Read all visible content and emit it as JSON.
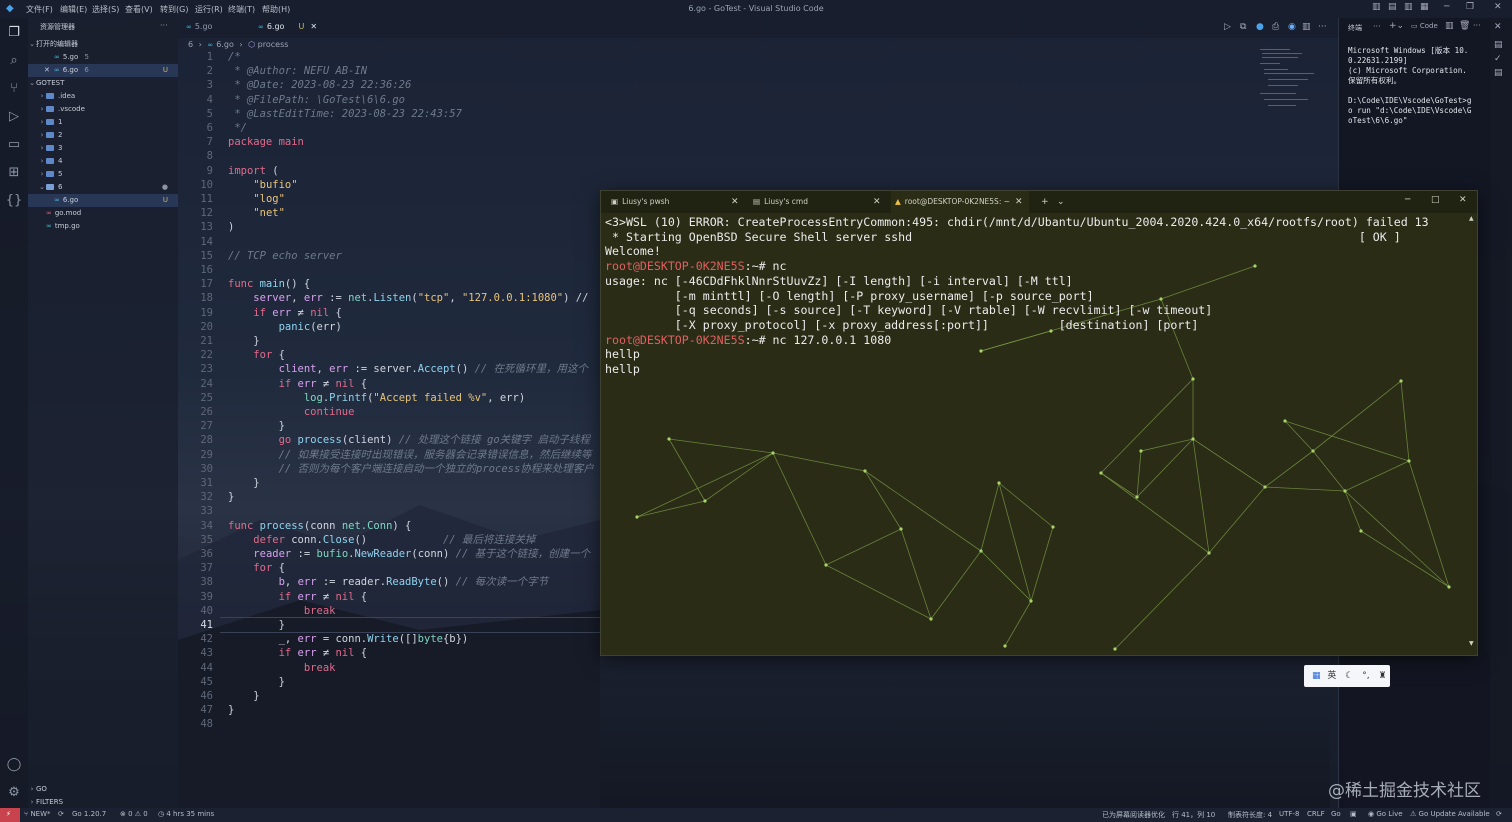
{
  "window": {
    "title": "6.go - GoTest - Visual Studio Code",
    "menu": [
      "文件(F)",
      "编辑(E)",
      "选择(S)",
      "查看(V)",
      "转到(G)",
      "运行(R)",
      "终端(T)",
      "帮助(H)"
    ]
  },
  "sidebar": {
    "header": "资源管理器",
    "open_editors_label": "打开的编辑器",
    "open_editors": [
      {
        "name": "5.go",
        "tag": "5",
        "badge": ""
      },
      {
        "name": "6.go",
        "tag": "6",
        "badge": "U"
      }
    ],
    "project_label": "GOTEST",
    "tree": [
      {
        "name": ".idea",
        "type": "folder"
      },
      {
        "name": ".vscode",
        "type": "folder"
      },
      {
        "name": "1",
        "type": "folder"
      },
      {
        "name": "2",
        "type": "folder"
      },
      {
        "name": "3",
        "type": "folder"
      },
      {
        "name": "4",
        "type": "folder"
      },
      {
        "name": "5",
        "type": "folder"
      },
      {
        "name": "6",
        "type": "folder-open"
      },
      {
        "name": "6.go",
        "type": "go-file",
        "badge": "U"
      },
      {
        "name": "go.mod",
        "type": "mod-file"
      },
      {
        "name": "tmp.go",
        "type": "go-file"
      }
    ],
    "bottom_sections": [
      "GO",
      "FILTERS"
    ]
  },
  "editor": {
    "tabs": [
      {
        "name": "5.go",
        "badge": ""
      },
      {
        "name": "6.go",
        "badge": "U"
      }
    ],
    "breadcrumb": [
      "6",
      "6.go",
      "process"
    ],
    "current_line": 41,
    "lines": [
      {
        "n": "1",
        "segs": [
          [
            "cmt",
            "/*"
          ]
        ]
      },
      {
        "n": "2",
        "segs": [
          [
            "cmt",
            " * @Author: NEFU AB-IN"
          ]
        ]
      },
      {
        "n": "3",
        "segs": [
          [
            "cmt",
            " * @Date: 2023-08-23 22:36:26"
          ]
        ]
      },
      {
        "n": "4",
        "segs": [
          [
            "cmt",
            " * @FilePath: \\GoTest\\6\\6.go"
          ]
        ]
      },
      {
        "n": "5",
        "segs": [
          [
            "cmt",
            " * @LastEditTime: 2023-08-23 22:43:57"
          ]
        ]
      },
      {
        "n": "6",
        "segs": [
          [
            "cmt",
            " */"
          ]
        ]
      },
      {
        "n": "7",
        "segs": [
          [
            "kw",
            "package "
          ],
          [
            "kw",
            "main"
          ]
        ]
      },
      {
        "n": "8",
        "segs": []
      },
      {
        "n": "9",
        "segs": [
          [
            "kw",
            "import "
          ],
          [
            "pl",
            "("
          ]
        ]
      },
      {
        "n": "10",
        "segs": [
          [
            "pl",
            "    "
          ],
          [
            "str",
            "\"bufio\""
          ]
        ]
      },
      {
        "n": "11",
        "segs": [
          [
            "pl",
            "    "
          ],
          [
            "str",
            "\"log\""
          ]
        ]
      },
      {
        "n": "12",
        "segs": [
          [
            "pl",
            "    "
          ],
          [
            "str",
            "\"net\""
          ]
        ]
      },
      {
        "n": "13",
        "segs": [
          [
            "pl",
            ")"
          ]
        ]
      },
      {
        "n": "14",
        "segs": []
      },
      {
        "n": "15",
        "segs": [
          [
            "cmt",
            "// TCP echo server"
          ]
        ]
      },
      {
        "n": "16",
        "segs": []
      },
      {
        "n": "17",
        "segs": [
          [
            "kw",
            "func "
          ],
          [
            "fn",
            "main"
          ],
          [
            "pl",
            "() {"
          ]
        ]
      },
      {
        "n": "18",
        "segs": [
          [
            "pl",
            "    "
          ],
          [
            "id",
            "server"
          ],
          [
            "pl",
            ", "
          ],
          [
            "id",
            "err"
          ],
          [
            "pl",
            " := "
          ],
          [
            "ty",
            "net"
          ],
          [
            "pl",
            "."
          ],
          [
            "fn",
            "Listen"
          ],
          [
            "pl",
            "("
          ],
          [
            "str",
            "\"tcp\""
          ],
          [
            "pl",
            ", "
          ],
          [
            "str",
            "\"127.0.0.1:1080\""
          ],
          [
            "pl",
            ") //"
          ]
        ]
      },
      {
        "n": "19",
        "segs": [
          [
            "pl",
            "    "
          ],
          [
            "kw",
            "if "
          ],
          [
            "id",
            "err"
          ],
          [
            "pl",
            " ≠ "
          ],
          [
            "kw",
            "nil"
          ],
          [
            "pl",
            " {"
          ]
        ]
      },
      {
        "n": "20",
        "segs": [
          [
            "pl",
            "        "
          ],
          [
            "fn",
            "panic"
          ],
          [
            "pl",
            "(err)"
          ]
        ]
      },
      {
        "n": "21",
        "segs": [
          [
            "pl",
            "    }"
          ]
        ]
      },
      {
        "n": "22",
        "segs": [
          [
            "pl",
            "    "
          ],
          [
            "kw",
            "for"
          ],
          [
            "pl",
            " {"
          ]
        ]
      },
      {
        "n": "23",
        "segs": [
          [
            "pl",
            "        "
          ],
          [
            "id",
            "client"
          ],
          [
            "pl",
            ", "
          ],
          [
            "id",
            "err"
          ],
          [
            "pl",
            " := server."
          ],
          [
            "fn",
            "Accept"
          ],
          [
            "pl",
            "() "
          ],
          [
            "cmt",
            "// 在死循环里，用这个"
          ]
        ]
      },
      {
        "n": "24",
        "segs": [
          [
            "pl",
            "        "
          ],
          [
            "kw",
            "if "
          ],
          [
            "id",
            "err"
          ],
          [
            "pl",
            " ≠ "
          ],
          [
            "kw",
            "nil"
          ],
          [
            "pl",
            " {"
          ]
        ]
      },
      {
        "n": "25",
        "segs": [
          [
            "pl",
            "            "
          ],
          [
            "ty",
            "log"
          ],
          [
            "pl",
            "."
          ],
          [
            "fn",
            "Printf"
          ],
          [
            "pl",
            "("
          ],
          [
            "str",
            "\"Accept failed %v\""
          ],
          [
            "pl",
            ", err)"
          ]
        ]
      },
      {
        "n": "26",
        "segs": [
          [
            "pl",
            "            "
          ],
          [
            "kw",
            "continue"
          ]
        ]
      },
      {
        "n": "27",
        "segs": [
          [
            "pl",
            "        }"
          ]
        ]
      },
      {
        "n": "28",
        "segs": [
          [
            "pl",
            "        "
          ],
          [
            "kw",
            "go "
          ],
          [
            "fn",
            "process"
          ],
          [
            "pl",
            "(client) "
          ],
          [
            "cmt",
            "// 处理这个链接 go关键字 启动子线程"
          ]
        ]
      },
      {
        "n": "29",
        "segs": [
          [
            "pl",
            "        "
          ],
          [
            "cmt",
            "// 如果接受连接时出现错误，服务器会记录错误信息，然后继续等"
          ]
        ]
      },
      {
        "n": "30",
        "segs": [
          [
            "pl",
            "        "
          ],
          [
            "cmt",
            "// 否则为每个客户端连接启动一个独立的process协程来处理客户"
          ]
        ]
      },
      {
        "n": "31",
        "segs": [
          [
            "pl",
            "    }"
          ]
        ]
      },
      {
        "n": "32",
        "segs": [
          [
            "pl",
            "}"
          ]
        ]
      },
      {
        "n": "33",
        "segs": []
      },
      {
        "n": "34",
        "segs": [
          [
            "kw",
            "func "
          ],
          [
            "fn",
            "process"
          ],
          [
            "pl",
            "(conn "
          ],
          [
            "ty",
            "net.Conn"
          ],
          [
            "pl",
            ") {"
          ]
        ]
      },
      {
        "n": "35",
        "segs": [
          [
            "pl",
            "    "
          ],
          [
            "kw",
            "defer "
          ],
          [
            "pl",
            "conn."
          ],
          [
            "fn",
            "Close"
          ],
          [
            "pl",
            "()            "
          ],
          [
            "cmt",
            "// 最后将连接关掉"
          ]
        ]
      },
      {
        "n": "36",
        "segs": [
          [
            "pl",
            "    "
          ],
          [
            "id",
            "reader"
          ],
          [
            "pl",
            " := "
          ],
          [
            "ty",
            "bufio"
          ],
          [
            "pl",
            "."
          ],
          [
            "fn",
            "NewReader"
          ],
          [
            "pl",
            "(conn) "
          ],
          [
            "cmt",
            "// 基于这个链接，创建一个"
          ]
        ]
      },
      {
        "n": "37",
        "segs": [
          [
            "pl",
            "    "
          ],
          [
            "kw",
            "for"
          ],
          [
            "pl",
            " {"
          ]
        ]
      },
      {
        "n": "38",
        "segs": [
          [
            "pl",
            "        "
          ],
          [
            "id",
            "b"
          ],
          [
            "pl",
            ", "
          ],
          [
            "id",
            "err"
          ],
          [
            "pl",
            " := reader."
          ],
          [
            "fn",
            "ReadByte"
          ],
          [
            "pl",
            "() "
          ],
          [
            "cmt",
            "// 每次读一个字节"
          ]
        ]
      },
      {
        "n": "39",
        "segs": [
          [
            "pl",
            "        "
          ],
          [
            "kw",
            "if "
          ],
          [
            "id",
            "err"
          ],
          [
            "pl",
            " ≠ "
          ],
          [
            "kw",
            "nil"
          ],
          [
            "pl",
            " {"
          ]
        ]
      },
      {
        "n": "40",
        "segs": [
          [
            "pl",
            "            "
          ],
          [
            "kw",
            "break"
          ]
        ]
      },
      {
        "n": "41",
        "segs": [
          [
            "pl",
            "        }"
          ]
        ]
      },
      {
        "n": "42",
        "segs": [
          [
            "pl",
            "        _, "
          ],
          [
            "id",
            "err"
          ],
          [
            "pl",
            " = conn."
          ],
          [
            "fn",
            "Write"
          ],
          [
            "pl",
            "([]"
          ],
          [
            "ty",
            "byte"
          ],
          [
            "pl",
            "{b})"
          ]
        ]
      },
      {
        "n": "43",
        "segs": [
          [
            "pl",
            "        "
          ],
          [
            "kw",
            "if "
          ],
          [
            "id",
            "err"
          ],
          [
            "pl",
            " ≠ "
          ],
          [
            "kw",
            "nil"
          ],
          [
            "pl",
            " {"
          ]
        ]
      },
      {
        "n": "44",
        "segs": [
          [
            "pl",
            "            "
          ],
          [
            "kw",
            "break"
          ]
        ]
      },
      {
        "n": "45",
        "segs": [
          [
            "pl",
            "        }"
          ]
        ]
      },
      {
        "n": "46",
        "segs": [
          [
            "pl",
            "    }"
          ]
        ]
      },
      {
        "n": "47",
        "segs": [
          [
            "pl",
            "}"
          ]
        ]
      },
      {
        "n": "48",
        "segs": []
      }
    ]
  },
  "right_panel": {
    "header": "终端",
    "code_label": "Code",
    "output": "Microsoft Windows [版本 10.\n0.22631.2199]\n(c) Microsoft Corporation.\n保留所有权利。\n\nD:\\Code\\IDE\\Vscode\\GoTest>g\no run \"d:\\Code\\IDE\\Vscode\\G\noTest\\6\\6.go\""
  },
  "terminal": {
    "tabs": [
      "Liusy's pwsh",
      "Liusy's cmd",
      "root@DESKTOP-0K2NE5S: ~"
    ],
    "active_tab": 2,
    "lines": [
      {
        "type": "text",
        "text": "<3>WSL (10) ERROR: CreateProcessEntryCommon:495: chdir(/mnt/d/Ubantu/Ubuntu_2004.2020.424.0_x64/rootfs/root) failed 13"
      },
      {
        "type": "text",
        "text": " * Starting OpenBSD Secure Shell server sshd                                                                [ OK ]"
      },
      {
        "type": "text",
        "text": "Welcome!"
      },
      {
        "type": "prompt",
        "prompt": "root@DESKTOP-0K2NE5S",
        "rest": ":~# nc"
      },
      {
        "type": "text",
        "text": "usage: nc [-46CDdFhklNnrStUuvZz] [-I length] [-i interval] [-M ttl]"
      },
      {
        "type": "text",
        "text": "          [-m minttl] [-O length] [-P proxy_username] [-p source_port]"
      },
      {
        "type": "text",
        "text": "          [-q seconds] [-s source] [-T keyword] [-V rtable] [-W recvlimit] [-w timeout]"
      },
      {
        "type": "text",
        "text": "          [-X proxy_protocol] [-x proxy_address[:port]]          [destination] [port]"
      },
      {
        "type": "prompt",
        "prompt": "root@DESKTOP-0K2NE5S",
        "rest": ":~# nc 127.0.0.1 1080"
      },
      {
        "type": "text",
        "text": "hellp"
      },
      {
        "type": "text",
        "text": "hellp"
      }
    ]
  },
  "ime": {
    "label": "英"
  },
  "watermark": "@稀土掘金技术社区",
  "statusbar": {
    "left": [
      "NEW*",
      "Go 1.20.7",
      "⊗ 0 ⚠ 0",
      "4 hrs 35 mins"
    ],
    "right": [
      "已为屏幕阅读器优化",
      "行 41，列 10",
      "制表符长度: 4",
      "UTF-8",
      "CRLF",
      "Go",
      "Go Live",
      "Go Update Available"
    ]
  }
}
